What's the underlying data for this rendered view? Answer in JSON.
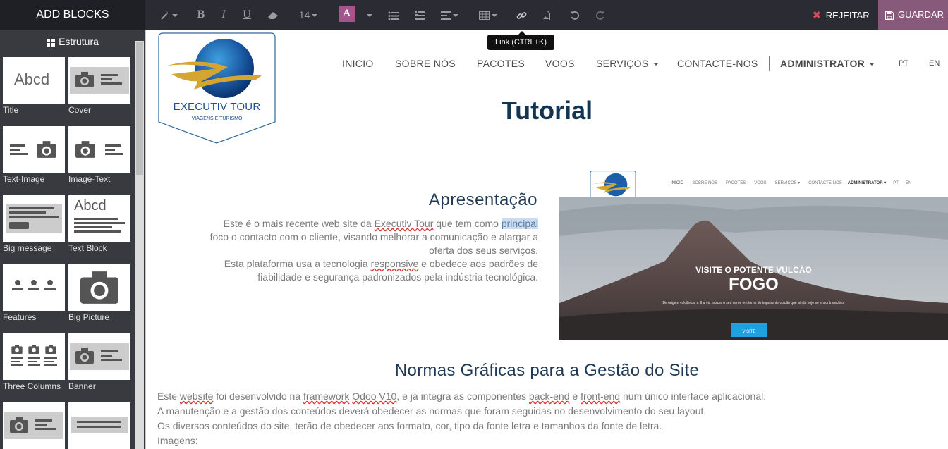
{
  "toolbar": {
    "add_blocks": "ADD BLOCKS",
    "font_size": "14",
    "font_color_label": "A",
    "link_tooltip": "Link (CTRL+K)",
    "reject_label": "REJEITAR",
    "save_label": "GUARDAR",
    "accent_color": "#875a7b"
  },
  "sidebar": {
    "section_title": "Estrutura",
    "blocks": [
      {
        "label": "Title",
        "thumb": "Abcd"
      },
      {
        "label": "Cover"
      },
      {
        "label": "Text-Image"
      },
      {
        "label": "Image-Text"
      },
      {
        "label": "Big message"
      },
      {
        "label": "Text Block",
        "thumb": "Abcd"
      },
      {
        "label": "Features"
      },
      {
        "label": "Big Picture"
      },
      {
        "label": "Three Columns"
      },
      {
        "label": "Banner"
      }
    ]
  },
  "site": {
    "logo_text": "EXECUTIV TOUR",
    "logo_sub": "VIAGENS E TURISMO",
    "nav": [
      "INICIO",
      "SOBRE NÓS",
      "PACOTES",
      "VOOS",
      "SERVIÇOS",
      "CONTACTE-NOS"
    ],
    "user": "ADMINISTRATOR",
    "langs": [
      "PT",
      "EN"
    ],
    "page_title": "Tutorial"
  },
  "presentation": {
    "title": "Apresentação",
    "line1_pre": "Este é o mais recente web site da ",
    "line1_link": "Executiv Tour",
    "line1_mid": " que  tem como ",
    "line1_hl": "principal",
    "line2": "foco o contacto com o  cliente, visando melhorar a comunicação e alargar a",
    "line3": "oferta dos seus serviços.",
    "line4_pre": "Esta plataforma usa a tecnologia ",
    "line4_link": "responsive",
    "line4_post": " e obedece aos padrões de",
    "line5": "fiabilidade e segurança padronizados pela indústria tecnológica."
  },
  "preview": {
    "nav": [
      "INICIO",
      "SOBRE NÓS",
      "PACOTES",
      "VOOS",
      "SERVIÇOS ▾",
      "CONTACTE-NOS",
      "ADMINISTRATOR ▾",
      "PT",
      "EN"
    ],
    "headline_small": "VISITE O POTENTE VULCÃO",
    "headline_big": "FOGO",
    "caption": "De origem vulcânica, a ilha viu nascer o seu nome em torno do imponente vulcão que ainda hoje se encontra activo.",
    "button": "VISITE"
  },
  "norms": {
    "title": "Normas Gráficas para a Gestão do Site",
    "p1_a": "Este ",
    "p1_b": "website",
    "p1_c": " foi desenvolvido na ",
    "p1_d": "framework",
    "p1_e": " ",
    "p1_f": "Odoo V10",
    "p1_g": ", e já integra as componentes ",
    "p1_h": "back-end",
    "p1_i": " e ",
    "p1_j": "front-end",
    "p1_k": " num único interface aplicacional.",
    "p2": "A manutenção e a gestão dos conteúdos deverá obedecer as normas que foram seguidas no desenvolvimento do seu layout.",
    "p3": "Os diversos conteúdos do site, terão de obedecer aos formato, cor, tipo da fonte letra e tamanhos da fonte de letra.",
    "p4": "Imagens:"
  }
}
